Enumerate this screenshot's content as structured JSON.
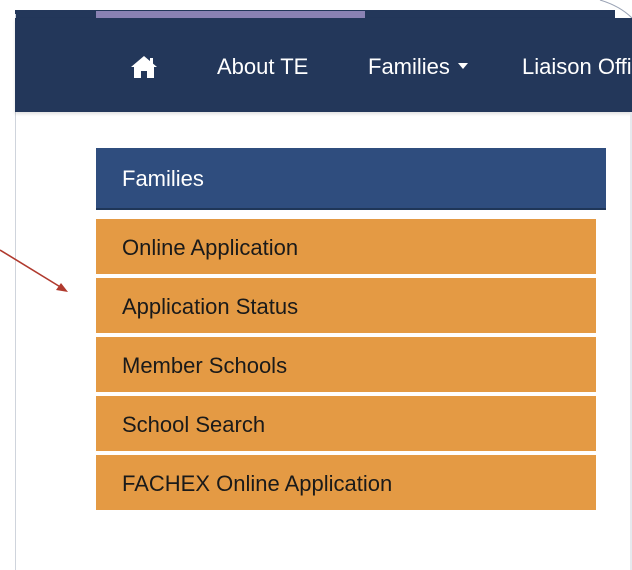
{
  "nav": {
    "home_icon": "home-icon",
    "items": [
      {
        "label": "About TE"
      },
      {
        "label": "Families"
      },
      {
        "label": "Liaison Offic"
      }
    ]
  },
  "panel": {
    "header": "Families",
    "items": [
      {
        "label": "Online Application"
      },
      {
        "label": "Application Status"
      },
      {
        "label": "Member Schools"
      },
      {
        "label": "School Search"
      },
      {
        "label": "FACHEX Online Application"
      }
    ]
  },
  "colors": {
    "navbar": "#23375a",
    "panel_header": "#2f4d7e",
    "panel_item": "#e49a44",
    "annotation_arrow": "#b03a2e",
    "accent_bar": "#8a82b4"
  }
}
